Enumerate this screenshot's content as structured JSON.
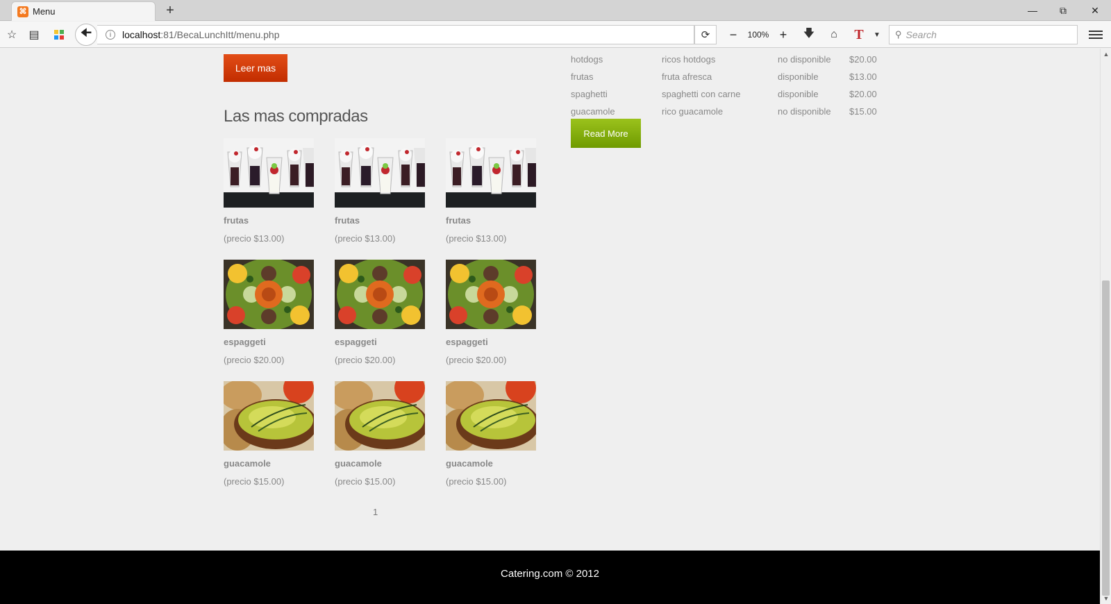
{
  "browser": {
    "tab_title": "Menu",
    "new_tab": "+",
    "url_host": "localhost",
    "url_rest": ":81/BecaLunchItt/menu.php",
    "zoom": "100%",
    "search_placeholder": "Search",
    "window_controls": {
      "minimize": "—",
      "restore": "⧉",
      "close": "✕"
    }
  },
  "left": {
    "read_more_button": "Leer mas",
    "section_title": "Las mas compradas",
    "products": [
      {
        "name": "frutas",
        "price": "(precio $13.00)",
        "image": "desserts-photo"
      },
      {
        "name": "frutas",
        "price": "(precio $13.00)",
        "image": "desserts-photo"
      },
      {
        "name": "frutas",
        "price": "(precio $13.00)",
        "image": "desserts-photo"
      },
      {
        "name": "espaggeti",
        "price": "(precio $20.00)",
        "image": "salad-photo"
      },
      {
        "name": "espaggeti",
        "price": "(precio $20.00)",
        "image": "salad-photo"
      },
      {
        "name": "espaggeti",
        "price": "(precio $20.00)",
        "image": "salad-photo"
      },
      {
        "name": "guacamole",
        "price": "(precio $15.00)",
        "image": "soup-photo"
      },
      {
        "name": "guacamole",
        "price": "(precio $15.00)",
        "image": "soup-photo"
      },
      {
        "name": "guacamole",
        "price": "(precio $15.00)",
        "image": "soup-photo"
      }
    ],
    "page_number": "1"
  },
  "right": {
    "menu_rows": [
      {
        "name": "hotdogs",
        "description": "ricos hotdogs",
        "status": "no disponible",
        "price": "$20.00"
      },
      {
        "name": "frutas",
        "description": "fruta afresca",
        "status": "disponible",
        "price": "$13.00"
      },
      {
        "name": "spaghetti",
        "description": "spaghetti con carne",
        "status": "disponible",
        "price": "$20.00"
      },
      {
        "name": "guacamole",
        "description": "rico guacamole",
        "status": "no disponible",
        "price": "$15.00"
      }
    ],
    "read_more_button": "Read More"
  },
  "footer": {
    "text": "Catering.com © 2012"
  },
  "colors": {
    "red_button": "#d8400a",
    "green_button": "#86ae0a",
    "footer_bg": "#000000",
    "page_bg": "#efefef"
  }
}
